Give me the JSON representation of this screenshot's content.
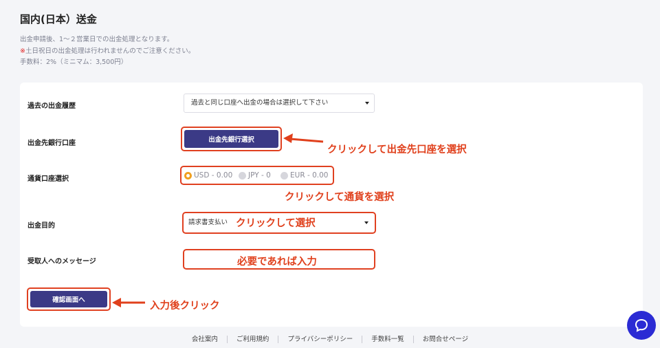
{
  "page": {
    "title": "国内(日本）送金",
    "notes": {
      "line1": "出金申請後、1〜２営業日での出金処理となります。",
      "line2_mark": "※",
      "line2": "土日祝日の出金処理は行われませんのでご注意ください。",
      "line3": "手数料：2%（ミニマム：3,500円）"
    }
  },
  "form": {
    "history": {
      "label": "過去の出金履歴",
      "selected": "過去と同じ口座へ出金の場合は選択して下さい"
    },
    "bank": {
      "label": "出金先銀行口座",
      "button": "出金先銀行選択"
    },
    "currency": {
      "label": "通貨口座選択",
      "options": [
        "USD - 0.00",
        "JPY - 0",
        "EUR - 0.00"
      ],
      "selected_index": 0
    },
    "purpose": {
      "label": "出金目的",
      "selected": "請求書支払い"
    },
    "message": {
      "label": "受取人へのメッセージ",
      "value": ""
    },
    "confirm_button": "確認画面へ"
  },
  "annotations": {
    "bank": "クリックして出金先口座を選択",
    "currency": "クリックして通貨を選択",
    "purpose": "クリックして選択",
    "message": "必要であれば入力",
    "confirm": "入力後クリック"
  },
  "footer": {
    "links": [
      "会社案内",
      "ご利用規約",
      "プライバシーポリシー",
      "手数料一覧",
      "お問合せページ"
    ]
  },
  "icons": {
    "chat": "chat-bubble-icon",
    "arrow": "arrow-left-icon"
  },
  "colors": {
    "primary": "#3b3a86",
    "annotation": "#e0401c",
    "radio_selected": "#f0a020",
    "chat": "#2b2bd4"
  }
}
